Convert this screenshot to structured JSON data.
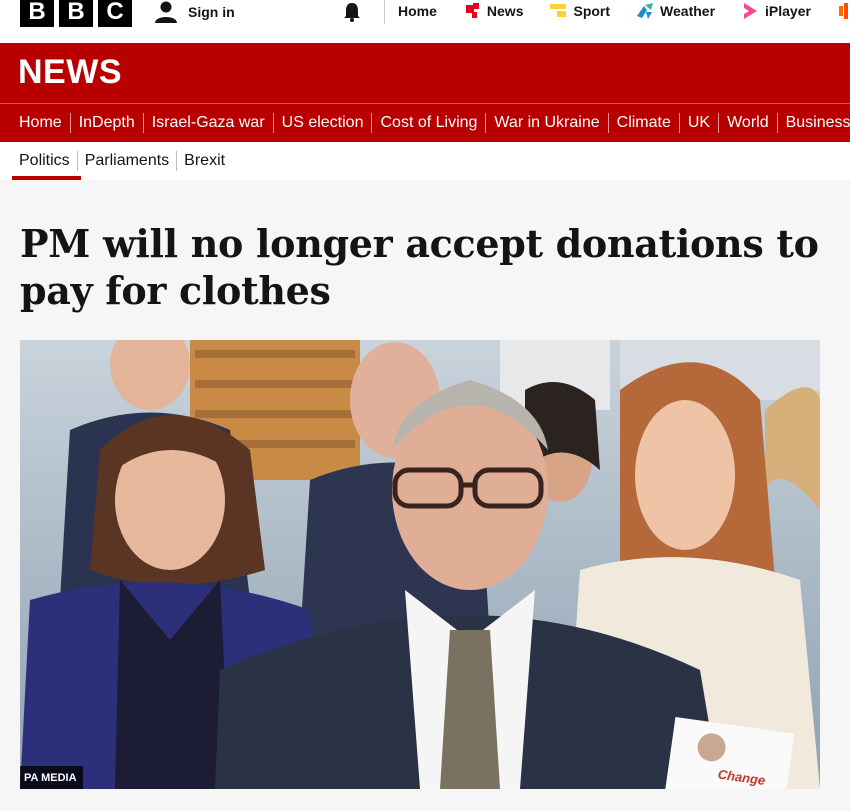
{
  "brand": {
    "letters": [
      "B",
      "B",
      "C"
    ]
  },
  "account": {
    "signin_label": "Sign in"
  },
  "topnav": [
    {
      "label": "Home",
      "icon": ""
    },
    {
      "label": "News",
      "icon": "news-icon",
      "color": "#e6001e"
    },
    {
      "label": "Sport",
      "icon": "sport-icon",
      "color": "#ffd230"
    },
    {
      "label": "Weather",
      "icon": "weather-icon",
      "color": "#1f8ccc"
    },
    {
      "label": "iPlayer",
      "icon": "iplayer-icon",
      "color": "#f54997"
    },
    {
      "label": "",
      "icon": "sounds-icon",
      "color": "#ff6b00"
    }
  ],
  "masthead": {
    "title": "NEWS",
    "color": "#b80000"
  },
  "mainnav": [
    "Home",
    "InDepth",
    "Israel-Gaza war",
    "US election",
    "Cost of Living",
    "War in Ukraine",
    "Climate",
    "UK",
    "World",
    "Business"
  ],
  "subnav": [
    "Politics",
    "Parliaments",
    "Brexit"
  ],
  "article": {
    "headline": "PM will no longer accept donations to pay for clothes",
    "image_credit": "PA MEDIA",
    "leaflet_text": "Change"
  }
}
